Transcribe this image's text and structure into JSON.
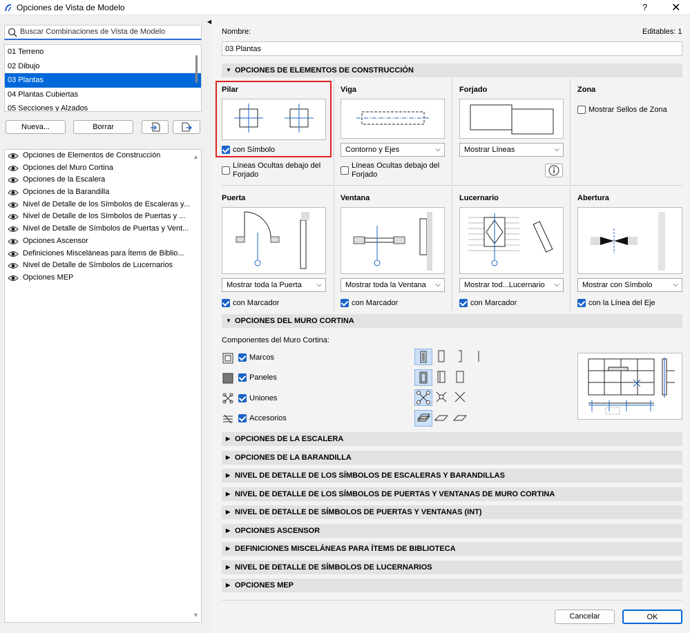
{
  "window": {
    "title": "Opciones de Vista de Modelo",
    "help": "?",
    "close": "✕"
  },
  "search": {
    "placeholder": "Buscar Combinaciones de Vista de Modelo"
  },
  "combinations": [
    {
      "label": "01 Terreno",
      "selected": false
    },
    {
      "label": "02 Dibujo",
      "selected": false
    },
    {
      "label": "03 Plantas",
      "selected": true
    },
    {
      "label": "04 Plantas Cubiertas",
      "selected": false
    },
    {
      "label": "05 Secciones y Alzados",
      "selected": false
    }
  ],
  "buttons": {
    "new": "Nueva...",
    "delete": "Borrar",
    "cancel": "Cancelar",
    "ok": "OK"
  },
  "options_list": [
    "Opciones de Elementos de Construcción",
    "Opciones del Muro Cortina",
    "Opciones de la Escalera",
    "Opciones de la Barandilla",
    "Nivel de Detalle de los Símbolos de Escaleras y...",
    "Nivel de Detalle de los Símbolos de Puertas y ...",
    "Nivel de Detalle de Símbolos de Puertas y Vent...",
    "Opciones Ascensor",
    "Definiciones Misceláneas para Ítems de Biblio...",
    "Nivel de Detalle de Símbolos de Lucernarios",
    "Opciones MEP"
  ],
  "name": {
    "label": "Nombre:",
    "value": "03 Plantas",
    "editables": "Editables: 1"
  },
  "section_construction": "OPCIONES DE ELEMENTOS DE CONSTRUCCIÓN",
  "pilar": {
    "title": "Pilar",
    "check": "con Símbolo",
    "checked": true,
    "hidden": "Líneas Ocultas debajo del Forjado"
  },
  "viga": {
    "title": "Viga",
    "select": "Contorno y Ejes",
    "hidden": "Líneas Ocultas debajo del Forjado"
  },
  "forjado": {
    "title": "Forjado",
    "select": "Mostrar Líneas"
  },
  "zona": {
    "title": "Zona",
    "check": "Mostrar Sellos de Zona"
  },
  "puerta": {
    "title": "Puerta",
    "select": "Mostrar toda la Puerta",
    "check": "con Marcador"
  },
  "ventana": {
    "title": "Ventana",
    "select": "Mostrar toda la Ventana",
    "check": "con Marcador"
  },
  "lucernario": {
    "title": "Lucernario",
    "select": "Mostrar tod...Lucernario",
    "check": "con Marcador"
  },
  "abertura": {
    "title": "Abertura",
    "select": "Mostrar con Símbolo",
    "check": "con la Línea del Eje"
  },
  "section_curtain": "OPCIONES DEL MURO CORTINA",
  "curtain": {
    "components_label": "Componentes del Muro Cortina:",
    "items": [
      "Marcos",
      "Paneles",
      "Uniones",
      "Accesorios"
    ]
  },
  "collapsed_sections": [
    "OPCIONES DE LA ESCALERA",
    "OPCIONES DE LA BARANDILLA",
    "NIVEL DE DETALLE DE LOS SÍMBOLOS DE ESCALERAS Y BARANDILLAS",
    "NIVEL DE DETALLE DE LOS SÍMBOLOS DE PUERTAS Y VENTANAS DE MURO CORTINA",
    "NIVEL DE DETALLE DE SÍMBOLOS DE PUERTAS Y VENTANAS (INT)",
    "OPCIONES ASCENSOR",
    "DEFINICIONES MISCELÁNEAS PARA ÍTEMS DE BIBLIOTECA",
    "NIVEL DE DETALLE DE SÍMBOLOS DE LUCERNARIOS",
    "OPCIONES MEP"
  ],
  "colors": {
    "accent": "#0068d8",
    "highlight": "#e02020",
    "check": "#1a63c9"
  }
}
